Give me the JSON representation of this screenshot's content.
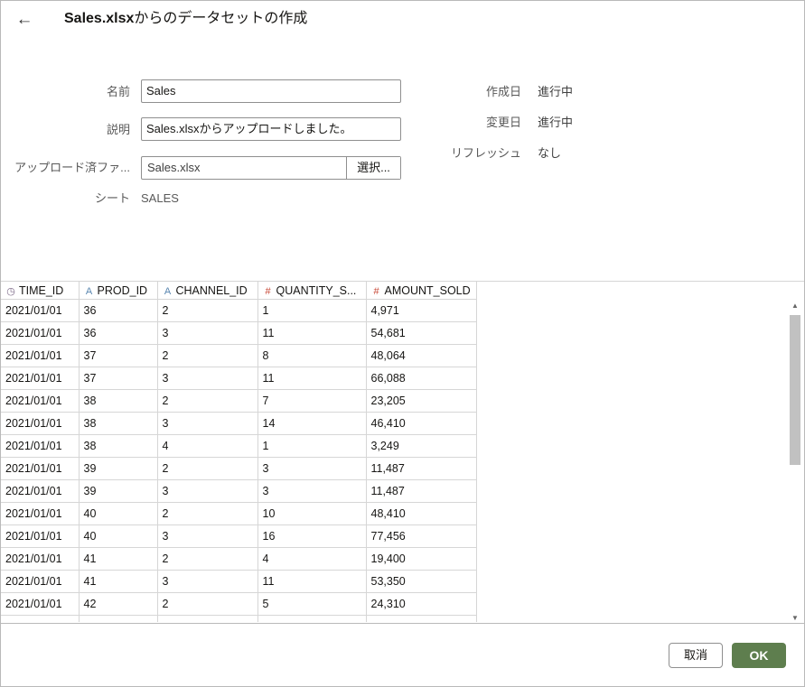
{
  "header": {
    "back_icon": "arrow-left-icon",
    "title_bold": "Sales.xlsx",
    "title_rest": "からのデータセットの作成"
  },
  "form": {
    "name_label": "名前",
    "name_value": "Sales",
    "desc_label": "説明",
    "desc_value": "Sales.xlsxからアップロードしました。",
    "upload_label": "アップロード済ファ...",
    "upload_value": "Sales.xlsx",
    "select_button": "選択...",
    "sheet_label": "シート",
    "sheet_value": "SALES"
  },
  "meta": {
    "created_label": "作成日",
    "created_value": "進行中",
    "modified_label": "変更日",
    "modified_value": "進行中",
    "refresh_label": "リフレッシュ",
    "refresh_value": "なし"
  },
  "table": {
    "columns": [
      {
        "label": "TIME_ID",
        "icon": "clock-icon",
        "glyph": "◷"
      },
      {
        "label": "PROD_ID",
        "icon": "text-type-icon",
        "glyph": "A"
      },
      {
        "label": "CHANNEL_ID",
        "icon": "text-type-icon",
        "glyph": "A"
      },
      {
        "label": "QUANTITY_S...",
        "icon": "number-type-icon",
        "glyph": "#"
      },
      {
        "label": "AMOUNT_SOLD",
        "icon": "number-type-icon",
        "glyph": "#"
      }
    ],
    "rows": [
      [
        "2021/01/01",
        "36",
        "2",
        "1",
        "4,971"
      ],
      [
        "2021/01/01",
        "36",
        "3",
        "11",
        "54,681"
      ],
      [
        "2021/01/01",
        "37",
        "2",
        "8",
        "48,064"
      ],
      [
        "2021/01/01",
        "37",
        "3",
        "11",
        "66,088"
      ],
      [
        "2021/01/01",
        "38",
        "2",
        "7",
        "23,205"
      ],
      [
        "2021/01/01",
        "38",
        "3",
        "14",
        "46,410"
      ],
      [
        "2021/01/01",
        "38",
        "4",
        "1",
        "3,249"
      ],
      [
        "2021/01/01",
        "39",
        "2",
        "3",
        "11,487"
      ],
      [
        "2021/01/01",
        "39",
        "3",
        "3",
        "11,487"
      ],
      [
        "2021/01/01",
        "40",
        "2",
        "10",
        "48,410"
      ],
      [
        "2021/01/01",
        "40",
        "3",
        "16",
        "77,456"
      ],
      [
        "2021/01/01",
        "41",
        "2",
        "4",
        "19,400"
      ],
      [
        "2021/01/01",
        "41",
        "3",
        "11",
        "53,350"
      ],
      [
        "2021/01/01",
        "42",
        "2",
        "5",
        "24,310"
      ],
      [
        "",
        "",
        "",
        "",
        ""
      ]
    ]
  },
  "footer": {
    "cancel_label": "取消",
    "ok_label": "OK"
  },
  "colors": {
    "ok_button": "#5e7e4e",
    "number_icon": "#c74634",
    "text_icon": "#5a87b0"
  }
}
